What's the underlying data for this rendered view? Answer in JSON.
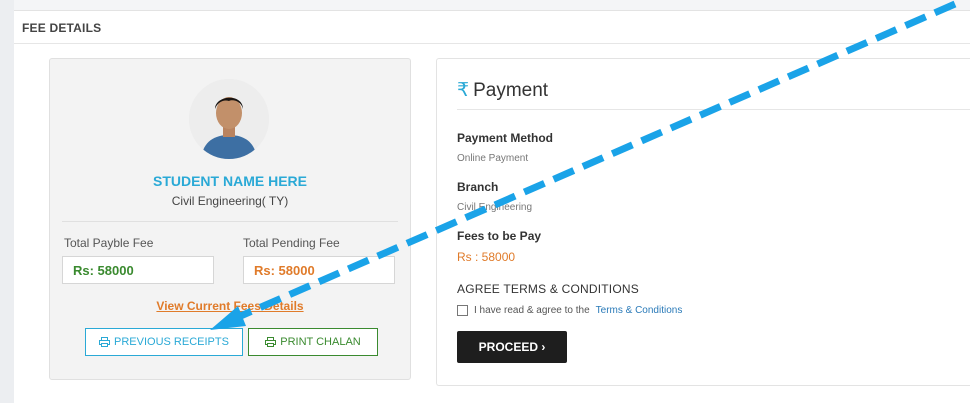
{
  "panel": {
    "title": "FEE DETAILS"
  },
  "student": {
    "name": "STUDENT NAME HERE",
    "course": "Civil Engineering( TY)",
    "total_payable_label": "Total Payble Fee",
    "total_payable_value": "Rs: 58000",
    "total_pending_label": "Total Pending Fee",
    "total_pending_value": "Rs: 58000",
    "view_link": "View Current Fees Details",
    "previous_receipts_button": "PREVIOUS RECEIPTS",
    "print_chalan_button": "PRINT CHALAN"
  },
  "payment": {
    "title": "Payment",
    "currency_symbol": "₹",
    "method_label": "Payment Method",
    "method_value": "Online Payment",
    "branch_label": "Branch",
    "branch_value": "Civil Engineering",
    "fees_label": "Fees to be Pay",
    "fees_value": "Rs : 58000",
    "terms_heading": "AGREE TERMS & CONDITIONS",
    "terms_text": "I have read & agree to the",
    "terms_link": "Terms & Conditions",
    "proceed_button": "PROCEED ›"
  },
  "colors": {
    "accent_blue": "#2aa9d6",
    "green": "#3a8a2f",
    "orange": "#e07b2a",
    "arrow": "#1aa3e8"
  },
  "icons": {
    "printer": "printer-icon",
    "rupee": "rupee-icon",
    "annotation": "annotation-arrow"
  }
}
